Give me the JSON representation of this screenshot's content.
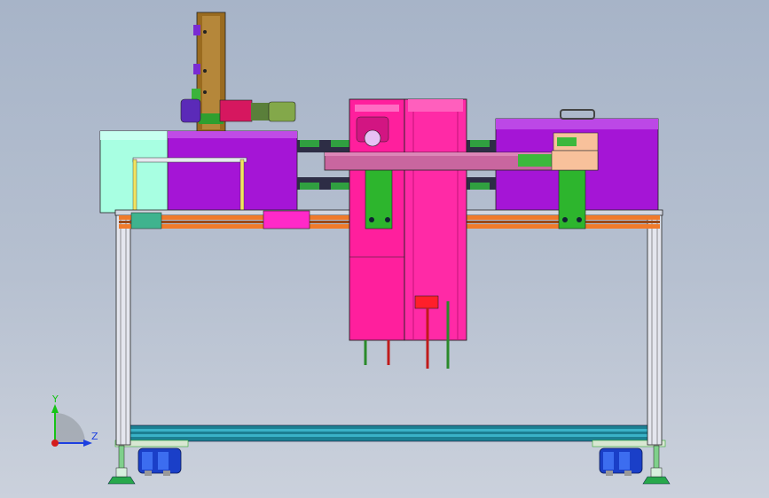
{
  "viewport": {
    "background_top": "#a7b4c8",
    "background_bottom": "#cbd1dc"
  },
  "model_colors": {
    "magenta": "#ff1f9d",
    "purple": "#a515d6",
    "mint": "#a8ffe2",
    "green": "#2db52d",
    "orange": "#f07a2a",
    "teal": "#1b8fa0",
    "blue": "#1a3fc8",
    "frame_gray": "#d9dde6"
  },
  "triad": {
    "y_label": "Y",
    "z_label": "Z",
    "y_color": "#17c317",
    "z_color": "#1c3fe0",
    "x_color": "#d41c1c"
  }
}
